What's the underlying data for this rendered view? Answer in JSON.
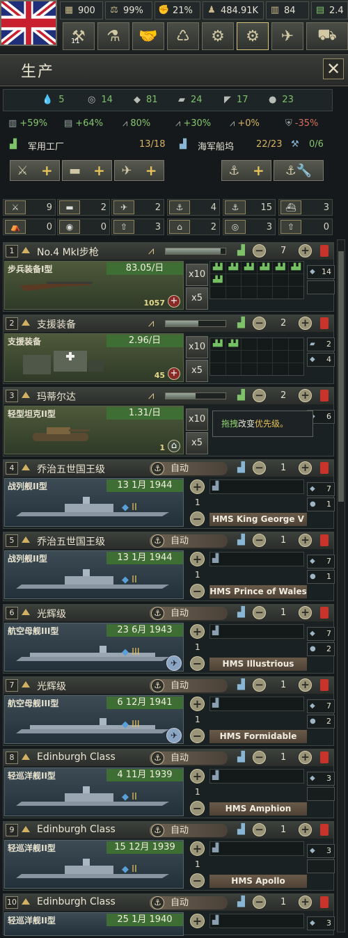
{
  "resources": {
    "political_power": "900",
    "stability": "99%",
    "war_support": "21%",
    "manpower": "484.91K",
    "factories": "84",
    "convoys": "2.4"
  },
  "window_title": "生产",
  "close_label": "✕",
  "materials": {
    "oil": "5",
    "rubber": "14",
    "steel": "81",
    "aluminium": "24",
    "tungsten": "17",
    "chromium": "23"
  },
  "modifiers": {
    "m1": "+59%",
    "m2": "+64%",
    "m3": "80%",
    "m4": "+30%",
    "m5": "+0%",
    "m6": "-35%"
  },
  "factory_info": {
    "military_label": "军用工厂",
    "military_value": "13/18",
    "dockyard_label": "海军船坞",
    "dockyard_value": "22/23",
    "refit_value": "0/6"
  },
  "category_counts": {
    "row1": [
      "9",
      "2",
      "2",
      "4",
      "15",
      "3"
    ],
    "row2": [
      "0",
      "0",
      "3",
      "2",
      "3",
      "0"
    ]
  },
  "lines": [
    {
      "num": "1",
      "name": "No.4 MkⅠ步枪",
      "factories": "7",
      "equip": "步兵装备I型",
      "rate": "83.05/日",
      "qty": "1057",
      "side1": "14",
      "x10": "x10",
      "x5": "x5"
    },
    {
      "num": "2",
      "name": "支援装备",
      "factories": "2",
      "equip": "支援装备",
      "rate": "2.96/日",
      "qty": "45",
      "side1": "2",
      "side2": "4",
      "x10": "x10",
      "x5": "x5"
    },
    {
      "num": "3",
      "name": "玛蒂尔达",
      "factories": "2",
      "equip": "轻型坦克II型",
      "rate": "1.31/日",
      "qty": "1",
      "side1": "6",
      "x10": "x10",
      "x5": "x5"
    }
  ],
  "tooltip": {
    "part1": "拖拽",
    "part2": "改变",
    "part3": "优先级。"
  },
  "ships": [
    {
      "num": "4",
      "name": "乔治五世国王级",
      "auto": "自动",
      "factories": "1",
      "type": "战列舰II型",
      "date": "13 1月 1944",
      "level": "II",
      "count": "1",
      "ship": "HMS King George V",
      "s1": "7",
      "s2": "1"
    },
    {
      "num": "5",
      "name": "乔治五世国王级",
      "auto": "自动",
      "factories": "1",
      "type": "战列舰II型",
      "date": "13 1月 1944",
      "level": "II",
      "count": "1",
      "ship": "HMS Prince of Wales",
      "s1": "7",
      "s2": "1"
    },
    {
      "num": "6",
      "name": "光辉级",
      "auto": "自动",
      "factories": "1",
      "type": "航空母舰III型",
      "date": "23 6月 1943",
      "level": "III",
      "count": "1",
      "ship": "HMS Illustrious",
      "s1": "7",
      "s2": "2"
    },
    {
      "num": "7",
      "name": "光辉级",
      "auto": "自动",
      "factories": "1",
      "type": "航空母舰III型",
      "date": "6 12月 1941",
      "level": "III",
      "count": "1",
      "ship": "HMS Formidable",
      "s1": "7",
      "s2": "2"
    },
    {
      "num": "8",
      "name": "Edinburgh Class",
      "auto": "自动",
      "factories": "1",
      "type": "轻巡洋舰II型",
      "date": "4 11月 1939",
      "level": "II",
      "count": "1",
      "ship": "HMS Amphion",
      "s1": "3"
    },
    {
      "num": "9",
      "name": "Edinburgh Class",
      "auto": "自动",
      "factories": "1",
      "type": "轻巡洋舰II型",
      "date": "15 12月 1939",
      "level": "II",
      "count": "1",
      "ship": "HMS Apollo",
      "s1": "3"
    },
    {
      "num": "10",
      "name": "Edinburgh Class",
      "auto": "自动",
      "factories": "1",
      "type": "轻巡洋舰II型",
      "date": "25 1月 1940",
      "level": "",
      "count": "",
      "ship": "",
      "s1": "3"
    }
  ]
}
